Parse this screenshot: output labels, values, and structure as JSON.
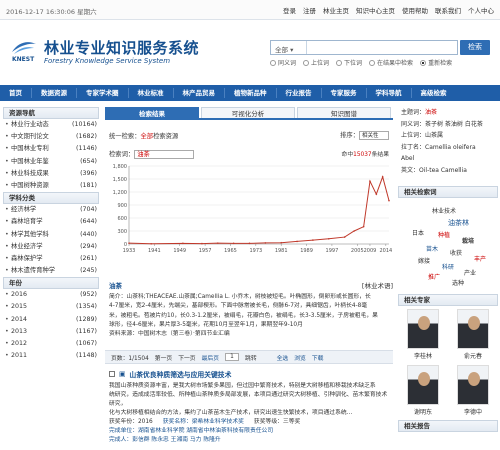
{
  "topbar": {
    "datetime": "2016-12-17 16:30:06 星期六",
    "links": [
      "登录",
      "注册",
      "林业主页",
      "知识中心主页",
      "使用帮助",
      "联系我们",
      "个人中心"
    ]
  },
  "brand": {
    "title": "林业专业知识服务系统",
    "subtitle": "Forestry Knowledge Service System",
    "mark": "KNEST"
  },
  "search": {
    "scope": "全部",
    "value": "",
    "button": "检索",
    "options": [
      "同义词",
      "上位词",
      "下位词",
      "在结果中检索",
      "重新检索"
    ],
    "selected_option": "重新检索"
  },
  "nav": [
    "首页",
    "数据资源",
    "专家学术圈",
    "林业标准",
    "林产品贸易",
    "植物新品种",
    "行业报告",
    "专家服务",
    "学科导航",
    "高级检索"
  ],
  "sidebar": {
    "resource_title": "资源导航",
    "resources": [
      {
        "label": "林业行业动态",
        "count": "(10164)"
      },
      {
        "label": "中文期刊论文",
        "count": "(1682)"
      },
      {
        "label": "中国林业专利",
        "count": "(1146)"
      },
      {
        "label": "中国林业年鉴",
        "count": "(654)"
      },
      {
        "label": "林业科技成果",
        "count": "(396)"
      },
      {
        "label": "中国树种资源",
        "count": "(181)"
      }
    ],
    "subject_title": "学科分类",
    "subjects": [
      {
        "label": "经济林学",
        "count": "(704)"
      },
      {
        "label": "森林培育学",
        "count": "(644)"
      },
      {
        "label": "林学其他学科",
        "count": "(440)"
      },
      {
        "label": "林业经济学",
        "count": "(294)"
      },
      {
        "label": "森林保护学",
        "count": "(261)"
      },
      {
        "label": "林木遗传育种学",
        "count": "(245)"
      }
    ],
    "year_title": "年份",
    "years": [
      {
        "label": "2016",
        "count": "(952)"
      },
      {
        "label": "2015",
        "count": "(1354)"
      },
      {
        "label": "2014",
        "count": "(1289)"
      },
      {
        "label": "2013",
        "count": "(1167)"
      },
      {
        "label": "2012",
        "count": "(1067)"
      },
      {
        "label": "2011",
        "count": "(1148)"
      }
    ]
  },
  "tabs": [
    "检索结果",
    "可视化分析",
    "知识图谱"
  ],
  "results": {
    "summary_prefix": "统一检索：",
    "summary_scope": "全部",
    "summary_suffix": "检索资源",
    "sort_label": "排序：",
    "sort_value": "相关性",
    "keyword_label": "检索词：",
    "keyword": "油茶",
    "hits_prefix": "命中",
    "hits": "15037",
    "hits_suffix": "条结果"
  },
  "chart_data": {
    "type": "line",
    "x": [
      1933,
      1940,
      1950,
      1956,
      1961,
      1966,
      1971,
      1976,
      1981,
      1986,
      1991,
      1996,
      2001,
      2004,
      2007,
      2009,
      2011,
      2013,
      2015
    ],
    "y": [
      20,
      5,
      15,
      10,
      20,
      15,
      15,
      25,
      30,
      60,
      90,
      120,
      160,
      300,
      400,
      1450,
      1150,
      1550,
      1000
    ],
    "xticks": [
      "1933",
      "1941",
      "1949",
      "1957",
      "1965",
      "1973",
      "1981",
      "1989",
      "1997",
      "2005",
      "2009",
      "2014"
    ],
    "yticks": [
      "0",
      "300",
      "600",
      "900",
      "1,200",
      "1,500",
      "1,800"
    ],
    "ylim": [
      0,
      1800
    ],
    "color": "#c0392b",
    "grid": true
  },
  "entry": {
    "title": "油茶",
    "source": "[林业术语]",
    "text1": "简介：山茶科;THEACEAE.山茶属;Camellia L. 小乔木，树枝被短毛。叶椭圆形，倒卵形或长圆形，长",
    "text2": "4-7厘米，宽2-4厘米，先端尖，基部楔形。下面中脉常被长毛，侧脉6-7对，具细锯齿，叶柄长4-8毫",
    "text3": "米，被粗毛。苞被片约10，长0.3-1.2厘米，被绢毛，花瓣白色，被绢毛，长3-3.5厘米，子房被粗毛，果",
    "text4": "球形，径4-6厘米，果片厚3-5毫米，花期10月至翌年1月，果期翌年9-10月",
    "text5": "资料来源：中国树木志（第三卷）·第四节业汇编"
  },
  "pager": {
    "info": "页数：1/1504",
    "first": "第一页",
    "next": "下一页",
    "last": "最后页",
    "page": "1",
    "go": "跳转",
    "select_all": "全选",
    "browse": "浏览",
    "download": "下载"
  },
  "article": {
    "title": "山茶优良种质筛选与应用关键技术",
    "text1": "我国山茶种质资源丰富，是我大树市场繁多果园，但过园中繁育技术，特别是大树移植和移栽技术缺乏系",
    "text2": "统研究，造成成活率较低、所种植山茶种质多局部发展，本项目通过研究大树移植、引种驯化、苗木繁育技术研究，",
    "text3": "化与大树移植相结合的方法，集约了山茶苗木生产技术，研究出速生快繁技术，项目通过系统...",
    "meta1": "获奖年份：2016",
    "meta2": "获奖名称：梁希林业科学技术奖",
    "meta3": "获奖等级：三等奖",
    "org": "完成单位：湖南省林业科学院  湖南省中林油茶科技有限责任公司",
    "people": "完成人：彭信群  陈永忠  王湘南  马力  陈隆升"
  },
  "info_panel": {
    "items": [
      {
        "k": "主题词：",
        "v": "油茶"
      },
      {
        "k": "同义词：",
        "v": "茶子树  茶油树  白花茶"
      },
      {
        "k": "上位词：",
        "v": "山茶属"
      },
      {
        "k": "拉丁名：",
        "v": "Camellia oleifera"
      },
      {
        "k": "",
        "v": "Abel"
      },
      {
        "k": "英文：",
        "v": "Oil-tea Camellia"
      }
    ]
  },
  "related_title": "相关检索词",
  "cloud": [
    "林业技术",
    "油茶林",
    "日本",
    "种植",
    "栽培",
    "苗木",
    "收获",
    "丰产",
    "嫁接",
    "科研",
    "产业",
    "推广",
    "选种"
  ],
  "expert_title": "相关专家",
  "experts": [
    "李桂林",
    "俞元春",
    "谢明东",
    "李德中"
  ],
  "report_title": "相关报告"
}
